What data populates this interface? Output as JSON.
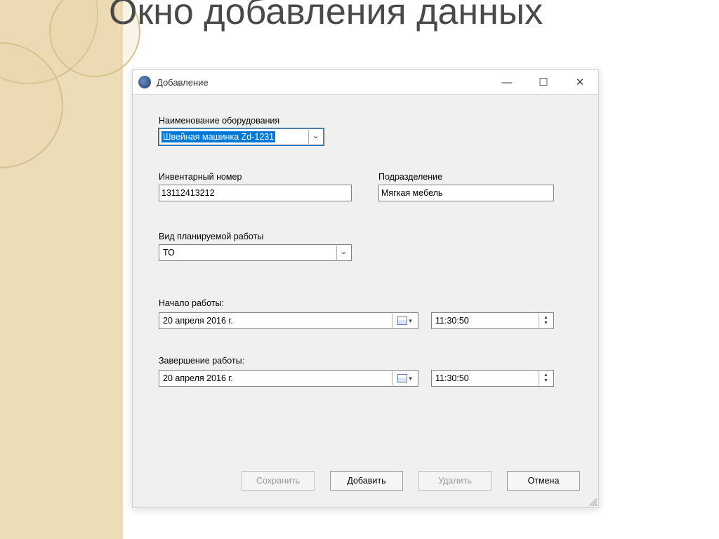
{
  "slide": {
    "title": "Окно добавления данных"
  },
  "window": {
    "title": "Добавление",
    "icon": "gear-globe-icon"
  },
  "labels": {
    "equipment_name": "Наименование оборудования",
    "inventory_number": "Инвентарный номер",
    "department": "Подразделение",
    "work_type": "Вид планируемой работы",
    "start": "Начало работы:",
    "finish": "Завершение работы:"
  },
  "values": {
    "equipment_name": "Швейная машинка Zd-1231",
    "inventory_number": "13112413212",
    "department": "Мягкая мебель",
    "work_type": "ТО",
    "start_date": "20  апреля   2016 г.",
    "start_time": "11:30:50",
    "finish_date": "20  апреля   2016 г.",
    "finish_time": "11:30:50"
  },
  "buttons": {
    "save": "Сохранить",
    "add": "Добавить",
    "delete": "Удалить",
    "cancel": "Отмена"
  }
}
